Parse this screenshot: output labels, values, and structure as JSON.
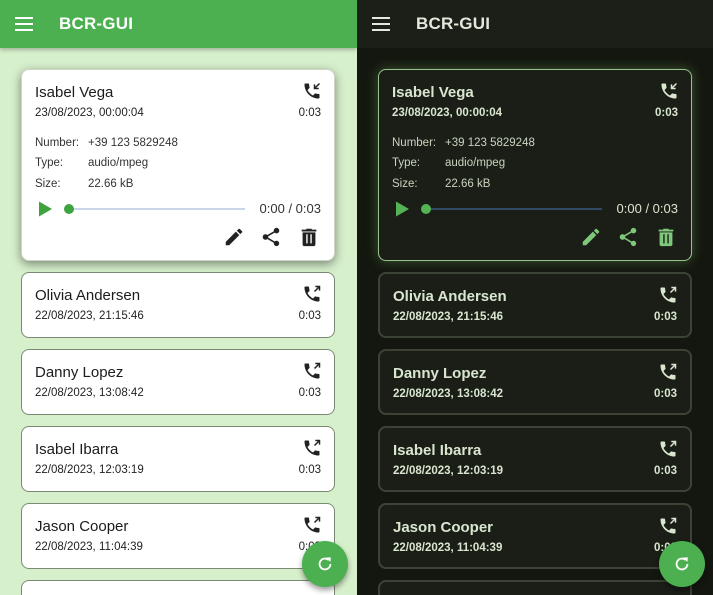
{
  "app": {
    "title": "BCR-GUI"
  },
  "recordings": [
    {
      "name": "Isabel Vega",
      "date": "23/08/2023, 00:00:04",
      "duration": "0:03",
      "direction": "incoming"
    },
    {
      "name": "Olivia Andersen",
      "date": "22/08/2023, 21:15:46",
      "duration": "0:03",
      "direction": "outgoing"
    },
    {
      "name": "Danny Lopez",
      "date": "22/08/2023, 13:08:42",
      "duration": "0:03",
      "direction": "outgoing"
    },
    {
      "name": "Isabel Ibarra",
      "date": "22/08/2023, 12:03:19",
      "duration": "0:03",
      "direction": "outgoing"
    },
    {
      "name": "Jason Cooper",
      "date": "22/08/2023, 11:04:39",
      "duration": "0:03",
      "direction": "outgoing"
    }
  ],
  "details": {
    "number_label": "Number:",
    "number": "+39 123 5829248",
    "type_label": "Type:",
    "type": "audio/mpeg",
    "size_label": "Size:",
    "size": "22.66 kB"
  },
  "player": {
    "time": "0:00 / 0:03",
    "progress": 0
  },
  "icons": {
    "menu": "menu-icon",
    "incoming": "call-received-icon",
    "outgoing": "call-made-icon",
    "play": "play-icon",
    "edit": "pencil-icon",
    "share": "share-icon",
    "delete": "trash-icon",
    "refresh": "refresh-icon"
  },
  "colors": {
    "light_bg": "#d7f0cc",
    "light_appbar": "#4caf50",
    "dark_bg": "#14170f",
    "dark_appbar": "#1b1f18",
    "accent": "#4caf50",
    "dark_text": "#d9e6cf"
  }
}
